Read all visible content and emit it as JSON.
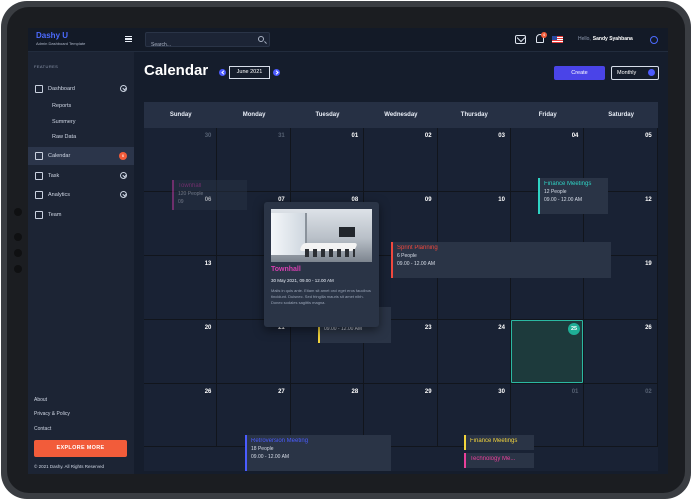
{
  "brand": {
    "name": "Dashy",
    "name_accent": "U",
    "subtitle": "Admin Dashboard Template"
  },
  "topbar": {
    "search_placeholder": "Search...",
    "notification_count": "4",
    "greeting": "Hello,",
    "user_name": "Sandy Syahbana"
  },
  "sidebar": {
    "section_label": "FEATURES",
    "items": [
      {
        "label": "Dashboard",
        "icon": "grid-icon"
      },
      {
        "label": "Calendar",
        "icon": "calendar-icon",
        "badge": "6"
      },
      {
        "label": "Task",
        "icon": "task-icon"
      },
      {
        "label": "Analytics",
        "icon": "analytics-icon"
      },
      {
        "label": "Team",
        "icon": "team-icon"
      }
    ],
    "subitems": [
      "Reports",
      "Summery",
      "Raw Data"
    ],
    "footer_links": [
      "About",
      "Privacy & Policy",
      "Contact"
    ],
    "cta_label": "EXPLORE MORE",
    "copyright": "© 2021 Dashy. All Rights Reserved"
  },
  "page": {
    "title": "Calendar",
    "current_month": "June 2021",
    "create_label": "Create",
    "view_label": "Monthly"
  },
  "calendar": {
    "weekdays": [
      "Sunday",
      "Monday",
      "Tuesday",
      "Wednesday",
      "Thursday",
      "Friday",
      "Saturday"
    ],
    "weeks": [
      [
        "30",
        "31",
        "01",
        "02",
        "03",
        "04",
        "05"
      ],
      [
        "06",
        "07",
        "08",
        "09",
        "10",
        "11",
        "12"
      ],
      [
        "13",
        "14",
        "15",
        "16",
        "17",
        "18",
        "19"
      ],
      [
        "20",
        "21",
        "22",
        "23",
        "24",
        "25",
        "26"
      ],
      [
        "26",
        "27",
        "28",
        "29",
        "30",
        "01",
        "02"
      ]
    ],
    "muted_note": "30, 31 (prev month) and 01, 02 (next month) are dimmed",
    "today": "24"
  },
  "events": [
    {
      "title": "Townhall",
      "sub1": "120 People",
      "sub2": "09",
      "color": "#d63fb0"
    },
    {
      "title": "Finance Meetings",
      "sub1": "12 People",
      "sub2": "09.00 - 12.00 AM",
      "color": "#2fd3c4"
    },
    {
      "title": "Sprint Planning",
      "sub1": "6 People",
      "sub2": "09.00 - 12.00 AM",
      "color": "#f0483e"
    },
    {
      "title": "Finance Meetings",
      "sub1": "12 People",
      "sub2": "09.00 - 12.00 AM",
      "color": "#f2d43d"
    },
    {
      "title": "Retroversion Meeting",
      "sub1": "18 People",
      "sub2": "09.00 - 12.00 AM",
      "color": "#4a5cff"
    },
    {
      "title": "Finance Meetings",
      "color": "#f2d43d"
    },
    {
      "title": "Technology Me...",
      "color": "#e9409a"
    }
  ],
  "popup": {
    "title": "Townhall",
    "date": "30 May 2021, 09.00 - 12.00 AM",
    "description": "Malis in quis ante. Etiam sit amet orci eget eros faucibus tincidunt. Duisnec. Sed fringilla mauris sit amet nibh. Donec sodales sagittis magna."
  },
  "colors": {
    "accent": "#4a44e8",
    "brand": "#4c6bff",
    "cta": "#f25c3a",
    "today": "#1fae96"
  }
}
